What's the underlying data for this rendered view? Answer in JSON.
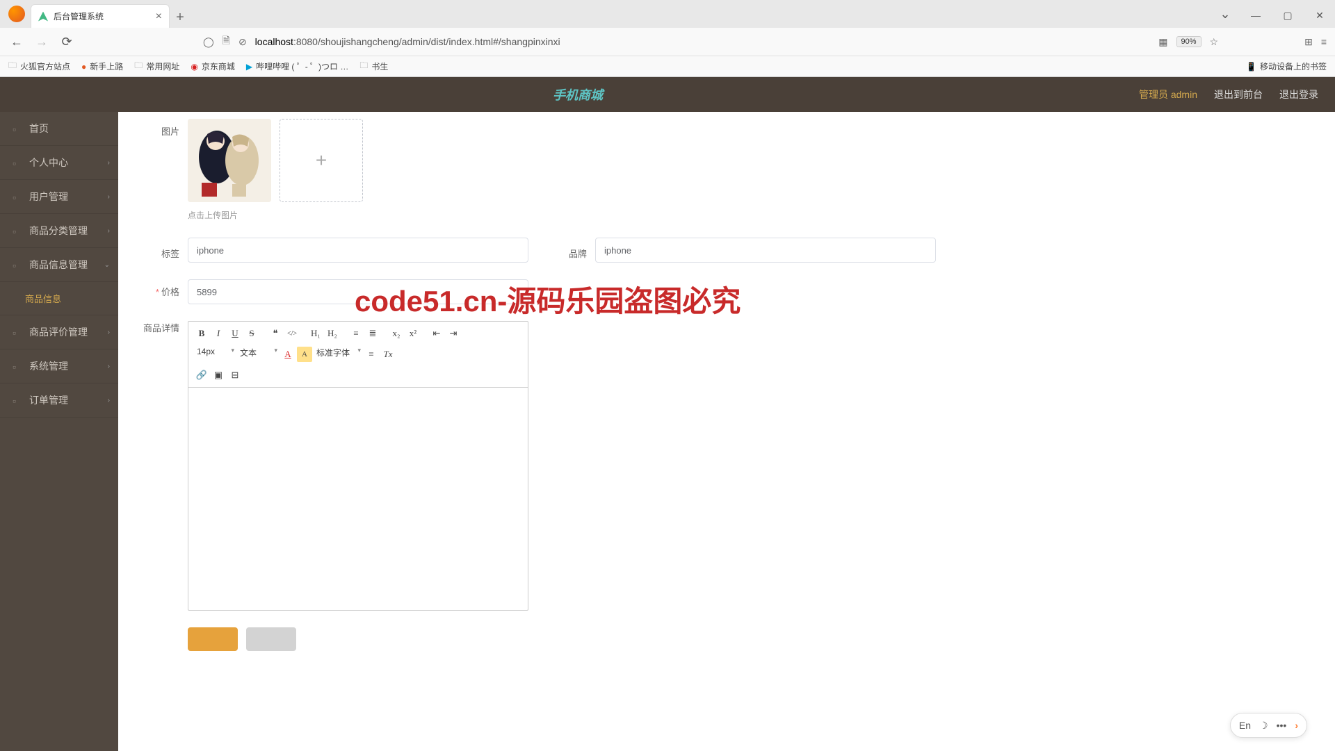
{
  "browser": {
    "tab_title": "后台管理系统",
    "new_tab": "+",
    "close": "×",
    "url_host": "localhost",
    "url_rest": ":8080/shoujishangcheng/admin/dist/index.html#/shangpinxinxi",
    "zoom": "90%",
    "chevron": "⌄",
    "bookmarks": [
      {
        "icon": "folder",
        "label": "火狐官方站点"
      },
      {
        "icon": "fire",
        "label": "新手上路"
      },
      {
        "icon": "folder",
        "label": "常用网址"
      },
      {
        "icon": "jd",
        "label": "京东商城"
      },
      {
        "icon": "bili",
        "label": "哔哩哔哩 ( ゜- ゜)つロ …"
      },
      {
        "icon": "folder",
        "label": "书生"
      }
    ],
    "bookmarks_right": "移动设备上的书签"
  },
  "window": {
    "min": "—",
    "max": "▢",
    "close": "✕"
  },
  "app": {
    "title": "手机商城",
    "header_links": {
      "admin": "管理员 admin",
      "front": "退出到前台",
      "logout": "退出登录"
    }
  },
  "sidebar": {
    "items": [
      {
        "label": "首页",
        "chev": ""
      },
      {
        "label": "个人中心",
        "chev": "›"
      },
      {
        "label": "用户管理",
        "chev": "›"
      },
      {
        "label": "商品分类管理",
        "chev": "›"
      },
      {
        "label": "商品信息管理",
        "chev": "⌄",
        "expanded": true
      },
      {
        "label": "商品信息",
        "sub": true,
        "active": true
      },
      {
        "label": "商品评价管理",
        "chev": "›"
      },
      {
        "label": "系统管理",
        "chev": "›"
      },
      {
        "label": "订单管理",
        "chev": "›"
      }
    ]
  },
  "form": {
    "image_label": "图片",
    "upload_hint": "点击上传图片",
    "tag_label": "标签",
    "tag_value": "iphone",
    "brand_label": "品牌",
    "brand_value": "iphone",
    "price_label": "价格",
    "price_value": "5899",
    "detail_label": "商品详情",
    "submit": "",
    "cancel": ""
  },
  "editor_toolbar": {
    "bold": "B",
    "italic": "I",
    "underline": "U",
    "strike": "S",
    "quote": "❝",
    "code": "</>",
    "h1": "H₁",
    "h2": "H₂",
    "ol": "≡",
    "ul": "≣",
    "sub": "x₂",
    "sup": "x²",
    "indent_l": "⇤",
    "indent_r": "⇥",
    "size": "14px",
    "block": "文本",
    "color_a": "A",
    "bg_a": "A",
    "font": "标准字体",
    "align": "≡",
    "clear": "Tx",
    "link": "🔗",
    "image": "▣",
    "video": "⊟"
  },
  "watermark": {
    "text": "code51.cn",
    "big": "code51.cn-源码乐园盗图必究"
  },
  "ime": {
    "lang": "En",
    "moon": "☽",
    "dots": "•••",
    "arrow": "›"
  }
}
